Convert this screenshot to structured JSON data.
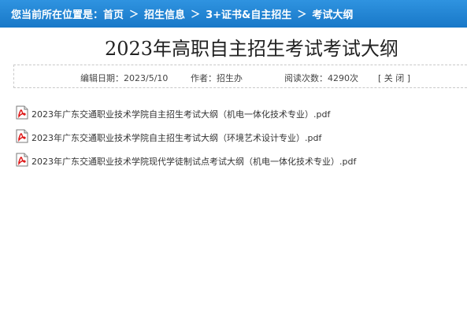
{
  "breadcrumb": {
    "prefix": "您当前所在位置是：",
    "separator": "＞",
    "items": [
      "首页",
      "招生信息",
      "3+证书&自主招生",
      "考试大纲"
    ]
  },
  "article": {
    "title": "2023年高职自主招生考试考试大纲",
    "meta": {
      "edit_date": "编辑日期：2023/5/10",
      "author": "作者：招生办",
      "views": "阅读次数：4290次",
      "close_label": "[ 关 闭 ]"
    }
  },
  "attachments": [
    {
      "name": "2023年广东交通职业技术学院自主招生考试大纲（机电一体化技术专业）.pdf",
      "icon": "pdf-icon"
    },
    {
      "name": "2023年广东交通职业技术学院自主招生考试大纲（环境艺术设计专业）.pdf",
      "icon": "pdf-icon"
    },
    {
      "name": "2023年广东交通职业技术学院现代学徒制试点考试大纲（机电一体化技术专业）.pdf",
      "icon": "pdf-icon"
    }
  ],
  "colors": {
    "header_bar": "#1f86d6",
    "text": "#333333"
  }
}
